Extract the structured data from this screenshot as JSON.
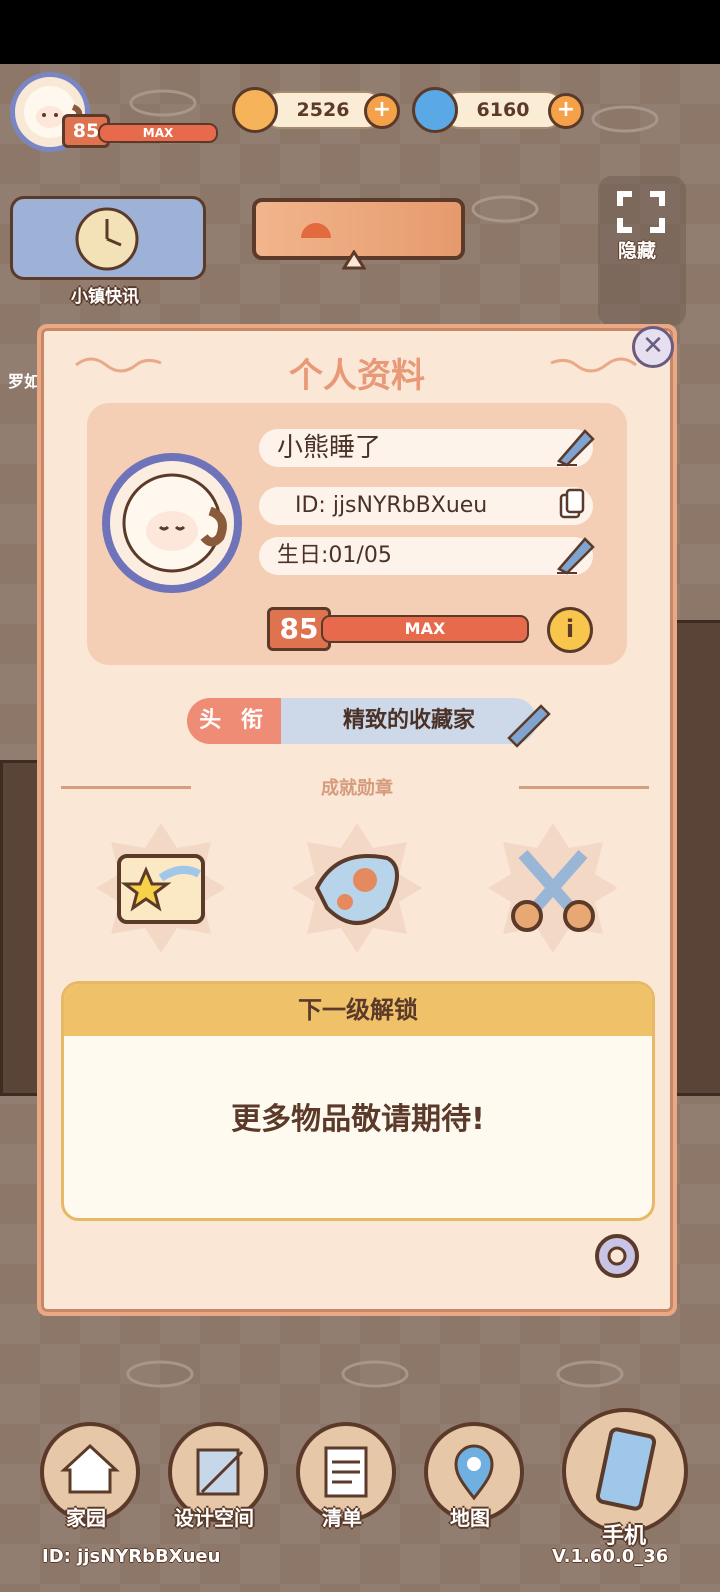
{
  "hud": {
    "level": "85",
    "level_bar": "MAX",
    "coins": "2526",
    "gems": "6160",
    "town_news_label": "小镇快讯",
    "hide_label": "隐藏",
    "side_label_partial": "罗如"
  },
  "panel": {
    "title": "个人资料",
    "nickname": "小熊睡了",
    "id_value": "ID: jjsNYRbBXueu",
    "birthday": "生日:01/05",
    "level": "85",
    "level_bar": "MAX",
    "title_tag_label": "头 衔",
    "title_tag_value": "精致的收藏家",
    "achievement_label": "成就勋章",
    "unlock_header": "下一级解锁",
    "unlock_message": "更多物品敬请期待!"
  },
  "nav": {
    "items": [
      {
        "label": "家园",
        "icon": "house-icon"
      },
      {
        "label": "设计空间",
        "icon": "design-ruler-icon"
      },
      {
        "label": "清单",
        "icon": "list-icon"
      },
      {
        "label": "地图",
        "icon": "map-pin-icon"
      },
      {
        "label": "手机",
        "icon": "phone-icon"
      }
    ]
  },
  "footer": {
    "player_id": "ID: jjsNYRbBXueu",
    "version": "V.1.60.0_36"
  },
  "colors": {
    "panel_bg": "#fbe7d6",
    "accent_orange": "#e66a4b",
    "avatar_ring": "#7a86c4"
  }
}
